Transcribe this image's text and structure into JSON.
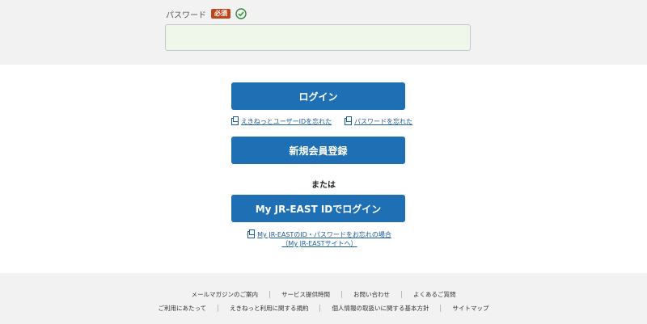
{
  "password": {
    "label": "パスワード",
    "required_badge": "必須",
    "value": "",
    "check_color": "#2e8b3a"
  },
  "buttons": {
    "login": "ログイン",
    "register": "新規会員登録",
    "jreast_login": "My JR-EAST IDでログイン"
  },
  "links": {
    "forgot_user_id": "えきねっとユーザーIDを忘れた",
    "forgot_password": "パスワードを忘れた",
    "jreast_forgot_line1": "My JR-EASTのID・パスワードをお忘れの場合",
    "jreast_forgot_line2": "（My JR-EASTサイトへ）"
  },
  "or_text": "または",
  "footer": {
    "row1": [
      "メールマガジンのご案内",
      "サービス提供時間",
      "お問い合わせ",
      "よくあるご質問"
    ],
    "row2": [
      "ご利用にあたって",
      "えきねっと利用に関する規約",
      "個人情報の取扱いに関する基本方針",
      "サイトマップ"
    ]
  },
  "colors": {
    "primary_button": "#1e6fb3",
    "link": "#1a5b9c",
    "badge": "#c0451a"
  }
}
